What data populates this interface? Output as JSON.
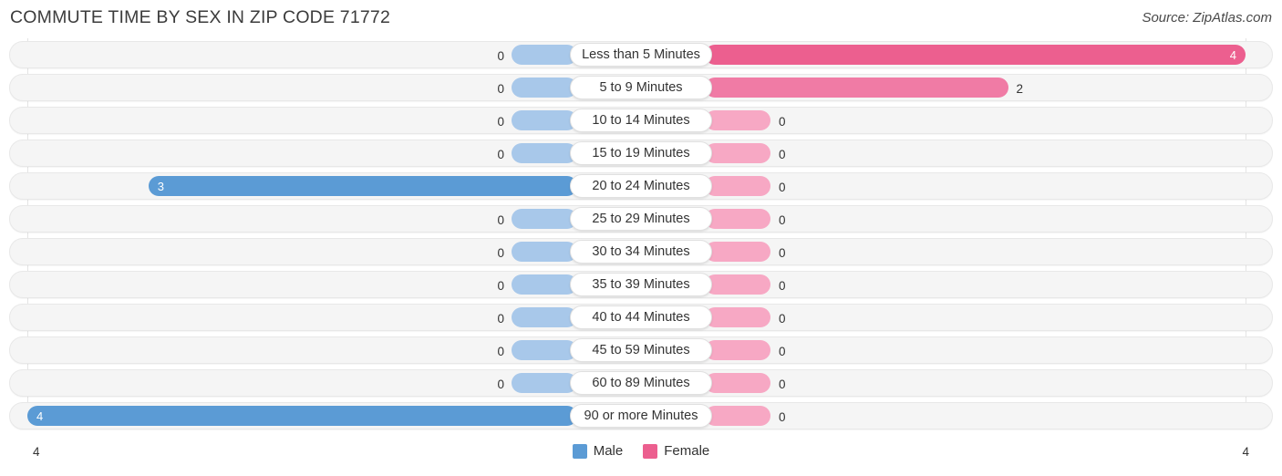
{
  "header": {
    "title": "COMMUTE TIME BY SEX IN ZIP CODE 71772",
    "source": "Source: ZipAtlas.com"
  },
  "legend": {
    "male_label": "Male",
    "female_label": "Female",
    "male_color": "#5b9bd5",
    "female_color": "#ec5f8f"
  },
  "axis": {
    "left_max": "4",
    "right_max": "4"
  },
  "chart_data": {
    "type": "bar",
    "title": "COMMUTE TIME BY SEX IN ZIP CODE 71772",
    "subtitle": "Source: ZipAtlas.com",
    "orientation": "horizontal-diverging",
    "xlabel": "",
    "ylabel": "",
    "xlim": [
      0,
      4
    ],
    "grid": true,
    "legend_position": "bottom-center",
    "categories": [
      "Less than 5 Minutes",
      "5 to 9 Minutes",
      "10 to 14 Minutes",
      "15 to 19 Minutes",
      "20 to 24 Minutes",
      "25 to 29 Minutes",
      "30 to 34 Minutes",
      "35 to 39 Minutes",
      "40 to 44 Minutes",
      "45 to 59 Minutes",
      "60 to 89 Minutes",
      "90 or more Minutes"
    ],
    "series": [
      {
        "name": "Male",
        "color": "#5b9bd5",
        "direction": "left",
        "values": [
          0,
          0,
          0,
          0,
          3,
          0,
          0,
          0,
          0,
          0,
          0,
          4
        ],
        "labels": [
          "0",
          "0",
          "0",
          "0",
          "3",
          "0",
          "0",
          "0",
          "0",
          "0",
          "0",
          "4"
        ]
      },
      {
        "name": "Female",
        "color": "#ec5f8f",
        "direction": "right",
        "values": [
          4,
          2,
          0,
          0,
          0,
          0,
          0,
          0,
          0,
          0,
          0,
          0
        ],
        "labels": [
          "4",
          "2",
          "0",
          "0",
          "0",
          "0",
          "0",
          "0",
          "0",
          "0",
          "0",
          "0"
        ]
      }
    ]
  }
}
